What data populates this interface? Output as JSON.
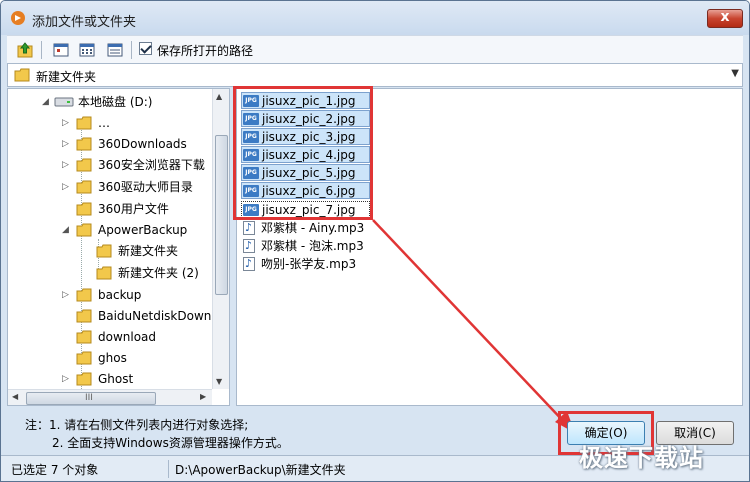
{
  "window": {
    "title": "添加文件或文件夹",
    "close_label": "x"
  },
  "toolbar": {
    "save_path_label": "保存所打开的路径",
    "save_path_checked": true
  },
  "path_bar": {
    "current": "新建文件夹"
  },
  "tree": {
    "drive": "本地磁盘 (D:)",
    "items": [
      "…",
      "360Downloads",
      "360安全浏览器下载",
      "360驱动大师目录",
      "360用户文件",
      "ApowerBackup",
      "新建文件夹",
      "新建文件夹 (2)",
      "backup",
      "BaiduNetdiskDownload",
      "download",
      "ghos",
      "Ghost"
    ],
    "hscroll_grip": "III"
  },
  "files": {
    "jpg_badge": "JPG",
    "items": [
      {
        "name": "jisuxz_pic_1.jpg",
        "type": "jpg"
      },
      {
        "name": "jisuxz_pic_2.jpg",
        "type": "jpg"
      },
      {
        "name": "jisuxz_pic_3.jpg",
        "type": "jpg"
      },
      {
        "name": "jisuxz_pic_4.jpg",
        "type": "jpg"
      },
      {
        "name": "jisuxz_pic_5.jpg",
        "type": "jpg"
      },
      {
        "name": "jisuxz_pic_6.jpg",
        "type": "jpg"
      },
      {
        "name": "jisuxz_pic_7.jpg",
        "type": "jpg"
      },
      {
        "name": "邓紫棋 - Ainy.mp3",
        "type": "mp3"
      },
      {
        "name": "邓紫棋 - 泡沫.mp3",
        "type": "mp3"
      },
      {
        "name": "吻别-张学友.mp3",
        "type": "mp3"
      }
    ]
  },
  "notes": {
    "line1": "注：1. 请在右侧文件列表内进行对象选择;",
    "line2": "2. 全面支持Windows资源管理器操作方式。"
  },
  "buttons": {
    "ok": "确定(O)",
    "cancel": "取消(C)"
  },
  "status": {
    "selected": "已选定 7 个对象",
    "path": "D:\\ApowerBackup\\新建文件夹"
  },
  "watermark": "极速下载站",
  "colors": {
    "highlight": "#e03535",
    "selection": "#cce4f9",
    "folder": "#f2c84b"
  }
}
